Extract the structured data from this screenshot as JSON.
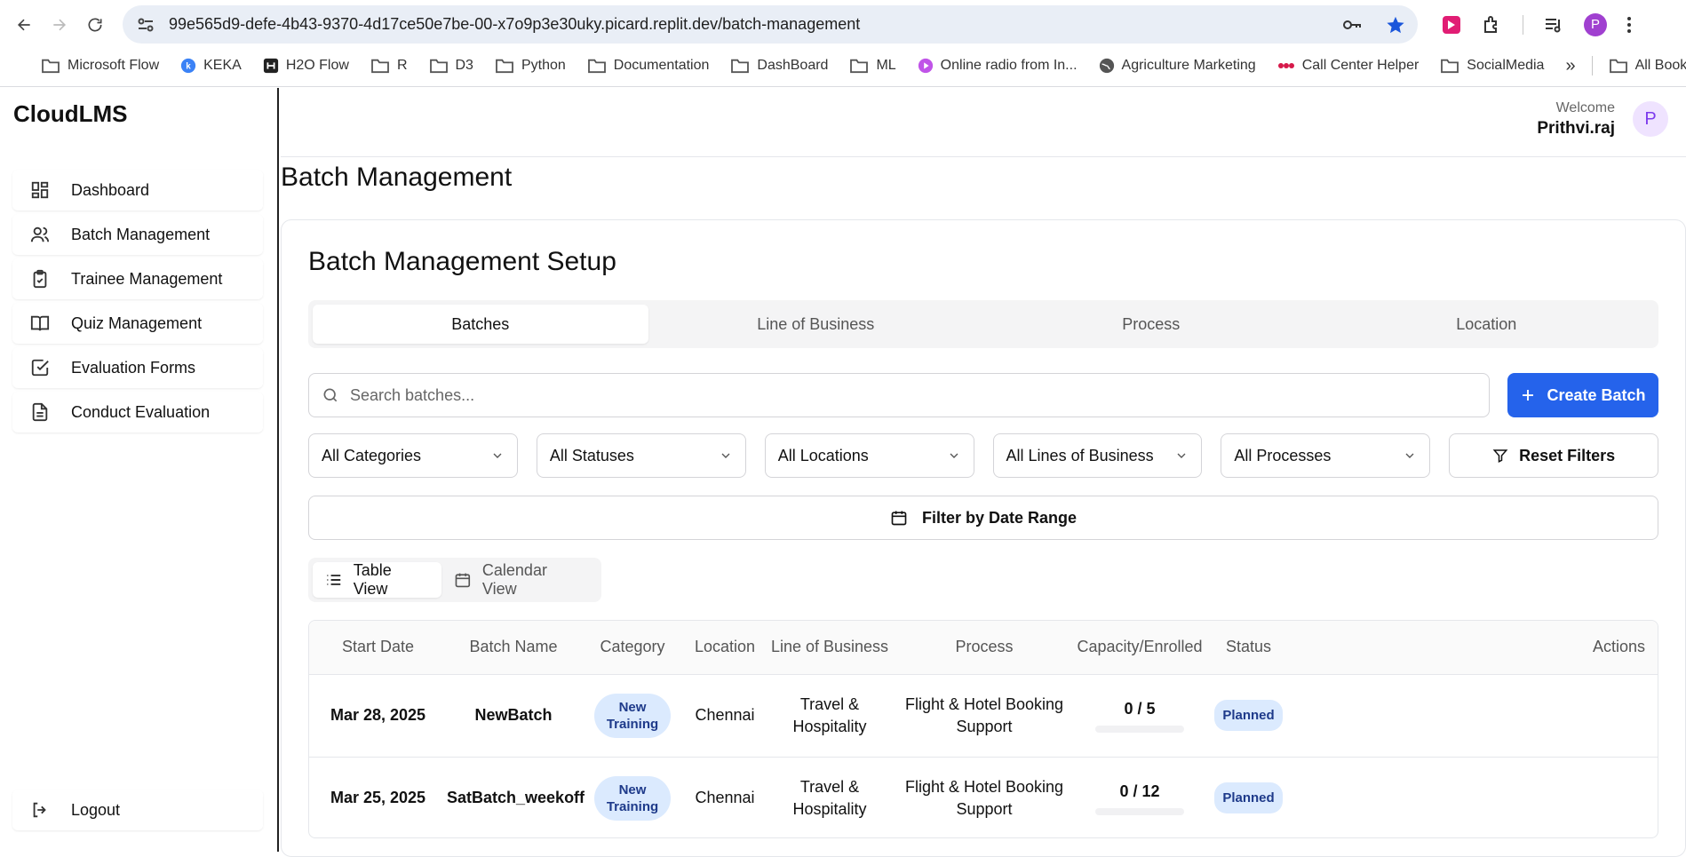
{
  "browser": {
    "url": "99e565d9-defe-4b43-9370-4d17ce50e7be-00-x7o9p3e30uky.picard.replit.dev/batch-management",
    "bookmarks": [
      {
        "label": "Microsoft Flow",
        "icon": "folder-icon"
      },
      {
        "label": "KEKA",
        "icon": "keka-icon"
      },
      {
        "label": "H2O Flow",
        "icon": "h2o-icon"
      },
      {
        "label": "R",
        "icon": "folder-icon"
      },
      {
        "label": "D3",
        "icon": "folder-icon"
      },
      {
        "label": "Python",
        "icon": "folder-icon"
      },
      {
        "label": "Documentation",
        "icon": "folder-icon"
      },
      {
        "label": "DashBoard",
        "icon": "folder-icon"
      },
      {
        "label": "ML",
        "icon": "folder-icon"
      },
      {
        "label": "Online radio from In...",
        "icon": "radio-icon"
      },
      {
        "label": "Agriculture Marketing",
        "icon": "globe-icon"
      },
      {
        "label": "Call Center Helper",
        "icon": "dots-icon"
      },
      {
        "label": "SocialMedia",
        "icon": "folder-icon"
      }
    ],
    "all_bookmarks": "All Bookmarks",
    "profile_initial": "P"
  },
  "sidebar": {
    "logo": "CloudLMS",
    "items": [
      {
        "label": "Dashboard",
        "icon": "grid-icon"
      },
      {
        "label": "Batch Management",
        "icon": "users-icon"
      },
      {
        "label": "Trainee Management",
        "icon": "clipboard-check-icon"
      },
      {
        "label": "Quiz Management",
        "icon": "book-open-icon"
      },
      {
        "label": "Evaluation Forms",
        "icon": "check-square-icon"
      },
      {
        "label": "Conduct Evaluation",
        "icon": "file-text-icon"
      }
    ],
    "logout": "Logout"
  },
  "header": {
    "welcome": "Welcome",
    "user_name": "Prithvi.raj",
    "avatar_initial": "P"
  },
  "page": {
    "title": "Batch Management",
    "card_title": "Batch Management Setup",
    "tabs": [
      "Batches",
      "Line of Business",
      "Process",
      "Location"
    ],
    "active_tab": "Batches",
    "search_placeholder": "Search batches...",
    "create_button": "Create Batch",
    "filters": [
      "All Categories",
      "All Statuses",
      "All Locations",
      "All Lines of Business",
      "All Processes"
    ],
    "reset_button": "Reset Filters",
    "date_range_button": "Filter by Date Range",
    "view_toggle": {
      "table": "Table View",
      "calendar": "Calendar View"
    }
  },
  "table": {
    "headers": [
      "Start Date",
      "Batch Name",
      "Category",
      "Location",
      "Line of Business",
      "Process",
      "Capacity/Enrolled",
      "Status",
      "Actions"
    ],
    "rows": [
      {
        "start_date": "Mar 28, 2025",
        "batch_name": "NewBatch",
        "category": "New Training",
        "location": "Chennai",
        "lob": "Travel & Hospitality",
        "process": "Flight & Hotel Booking Support",
        "capacity": "0 / 5",
        "enrolled_fraction": 0,
        "status": "Planned"
      },
      {
        "start_date": "Mar 25, 2025",
        "batch_name": "SatBatch_weekoff",
        "category": "New Training",
        "location": "Chennai",
        "lob": "Travel & Hospitality",
        "process": "Flight & Hotel Booking Support",
        "capacity": "0 / 12",
        "enrolled_fraction": 0,
        "status": "Planned"
      }
    ]
  },
  "colors": {
    "primary": "#2563eb",
    "badge_bg": "#dbeafe",
    "badge_text": "#1e3a8a",
    "avatar_bg": "#efe3ff",
    "avatar_text": "#7c3aed"
  }
}
